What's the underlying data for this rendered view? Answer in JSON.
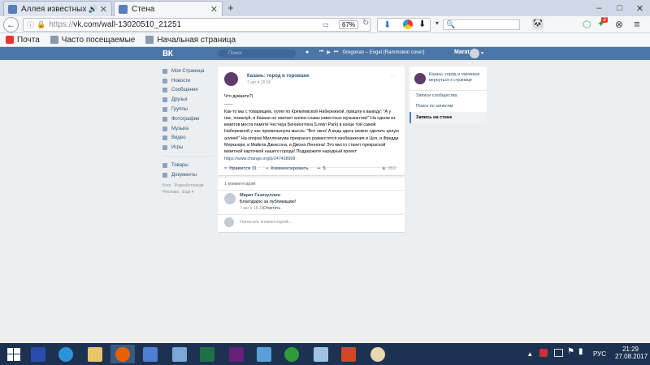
{
  "browser": {
    "tabs": [
      {
        "label": "Аллея известных музык",
        "state": "inactive"
      },
      {
        "label": "Стена",
        "state": "active"
      }
    ],
    "new_tab": "+",
    "url_prefix": "https://",
    "url_rest": "vk.com/wall-13020510_21251",
    "zoom": "67%",
    "notify_count": "3",
    "window_controls": [
      "–",
      "□",
      "✕"
    ]
  },
  "bookmarks": [
    {
      "label": "Почта",
      "icon": "mail-icon"
    },
    {
      "label": "Часто посещаемые",
      "icon": "star-icon"
    },
    {
      "label": "Начальная страница",
      "icon": "home-icon"
    }
  ],
  "vk": {
    "logo": "ВК",
    "search_placeholder": "Поиск",
    "now_playing": "Gregorian – Engel (Rammstein cover)",
    "user": "Marat",
    "left_menu": [
      "Моя Страница",
      "Новости",
      "Сообщения",
      "Друзья",
      "Группы",
      "Фотографии",
      "Музыка",
      "Видео",
      "Игры"
    ],
    "left_menu2": [
      "Товары",
      "Документы"
    ],
    "footer": [
      "Блог",
      "Разработчикам",
      "Реклама",
      "Ещё"
    ],
    "post": {
      "group": "Казань: город и горожане",
      "date": "7 авг в 15:56",
      "question": "Что думаете?)",
      "sep": "------",
      "body": "Как-то мы с товарищем, гуляя по Кремлевской Набережной, пришли к выводу: \"А у нас, пожалуй, в Казани не хватает аллеи славы известных музыкантов!\" На одном из визитов места памяти Честера Беннингтона (Linkin Park) в конце той самой Набережной у нас промелькнула мысль: \"Вот окно! А ведь здесь можно сделать целую аллею!\" На опорах Миллениума прекрасно разместятся изображения и Цоя, и Фредди Меркьюри, и Майкла Джексона, и Джона Леннона! Это место станет прекрасной визитной карточкой нашего города! Поддержите народный проект ",
      "link": "https://www.change.org/p/247428909",
      "likes": "Нравится  11",
      "comment_label": "Комментировать",
      "reposts": "5",
      "views": "859",
      "menu": "···"
    },
    "comments": {
      "count": "1 комментарий",
      "author": "Марат Газизуллин",
      "text": "Благодарю за публикацию!",
      "date": "7 авг в 18:35",
      "reply": "Ответить",
      "placeholder": "Написать комментарий..."
    },
    "right": {
      "group": "Казань: город и горожане",
      "back": "вернуться к странице",
      "links": [
        "Записи сообщества",
        "Поиск по записям",
        "Запись на стене"
      ]
    }
  },
  "taskbar": {
    "lang": "РУС",
    "time": "21:29",
    "date": "27.08.2017",
    "apps": [
      "windows-logo",
      "xp-app",
      "internet-explorer",
      "file-explorer",
      "firefox",
      "speaker-app",
      "remote-desktop",
      "excel",
      "visual-studio",
      "control-panel",
      "utorrent",
      "notepad",
      "powerpoint",
      "paint"
    ]
  },
  "colors": {
    "vk_blue": "#4a76a8",
    "link": "#285473",
    "taskbar": "#1d3251",
    "page_bg": "#edeef0"
  }
}
